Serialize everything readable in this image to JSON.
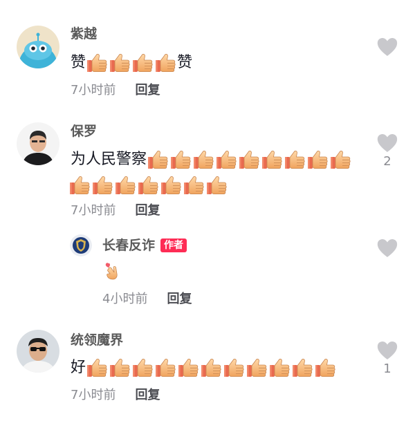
{
  "comments": [
    {
      "author": "紫越",
      "text_before": "赞",
      "thumbs_line1": 4,
      "text_after": "赞",
      "time": "7小时前",
      "reply_label": "回复",
      "like_count": ""
    },
    {
      "author": "保罗",
      "text_before": "为人民警察",
      "thumbs_line1": 9,
      "thumbs_line2": 7,
      "time": "7小时前",
      "reply_label": "回复",
      "like_count": "2",
      "replies": [
        {
          "author": "长春反诈",
          "badge": "作者",
          "emoji_icon": "finger-heart-emoji",
          "time": "4小时前",
          "reply_label": "回复",
          "like_count": ""
        }
      ]
    },
    {
      "author": "统领魔界",
      "text_before": "好",
      "thumbs_line1": 11,
      "time": "7小时前",
      "reply_label": "回复",
      "like_count": "1"
    }
  ],
  "colors": {
    "author": "#5a5a5a",
    "meta": "#8a8b91",
    "badge": "#fe2c55",
    "heart": "#c8c8cc",
    "thumb": "#f5b97a"
  },
  "icons": {
    "like": "heart-icon",
    "thumb": "thumbs-up-emoji"
  }
}
